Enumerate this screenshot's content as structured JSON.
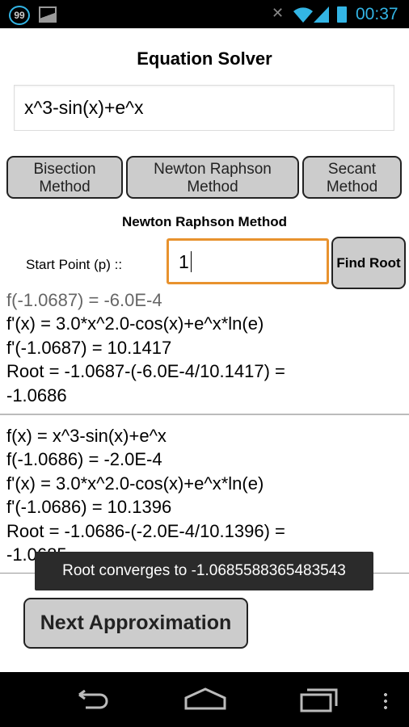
{
  "status_bar": {
    "notification_count": "99",
    "time": "00:37",
    "icons": [
      "notification-99-icon",
      "image-icon",
      "mute-icon",
      "wifi-icon",
      "signal-icon",
      "battery-icon"
    ]
  },
  "title": "Equation Solver",
  "equation": "x^3-sin(x)+e^x",
  "methods": [
    {
      "line1": "Bisection",
      "line2": "Method"
    },
    {
      "line1": "Newton Raphson",
      "line2": "Method"
    },
    {
      "line1": "Secant",
      "line2": "Method"
    }
  ],
  "method_label": "Newton Raphson Method",
  "start_point_label": "Start Point (p) ::",
  "start_point_value": "1",
  "find_root": "Find Root",
  "log_blocks": [
    [
      "f(-1.0687) = -6.0E-4",
      "f'(x) = 3.0*x^2.0-cos(x)+e^x*ln(e)",
      "f'(-1.0687) = 10.1417",
      "Root = -1.0687-(-6.0E-4/10.1417) =",
      "-1.0686"
    ],
    [
      "f(x) = x^3-sin(x)+e^x",
      "f(-1.0686) = -2.0E-4",
      "f'(x) = 3.0*x^2.0-cos(x)+e^x*ln(e)",
      "f'(-1.0686) = 10.1396",
      "Root = -1.0686-(-2.0E-4/10.1396) =",
      "-1.0685"
    ]
  ],
  "toast": "Root converges to -1.0685588365483543",
  "next_button": "Next Approximation",
  "colors": {
    "accent": "#e8922e",
    "status_icons": "#33b5e5"
  }
}
